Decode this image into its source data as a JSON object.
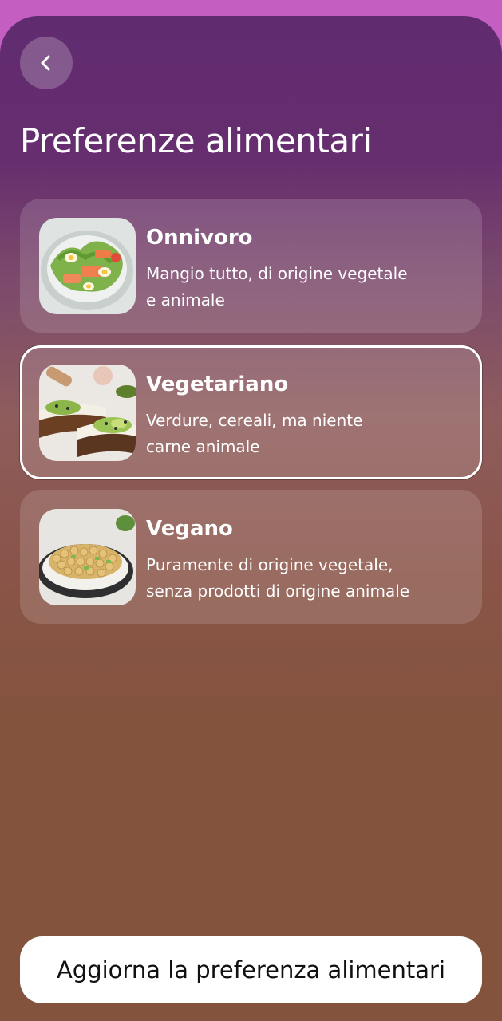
{
  "screen": {
    "title": "Preferenze alimentari",
    "back_icon": "chevron-left-icon"
  },
  "options": [
    {
      "label": "Onnivoro",
      "desc_line1": "Mangio tutto, di origine vegetale",
      "desc_line2": "e animale",
      "image": "salad-with-salmon-and-eggs-image",
      "selected": false
    },
    {
      "label": "Vegetariano",
      "desc_line1": "Verdure, cereali, ma niente",
      "desc_line2": "carne animale",
      "image": "avocado-toast-image",
      "selected": true
    },
    {
      "label": "Vegano",
      "desc_line1": "Puramente di origine vegetale,",
      "desc_line2": "senza prodotti di origine animale",
      "image": "chickpea-salad-image",
      "selected": false
    }
  ],
  "footer": {
    "cta_label": "Aggiorna la preferenza alimentari"
  },
  "colors": {
    "header_purple": "#612b70",
    "body_brown": "#83533d",
    "status_bar_magenta": "#c45ec0",
    "selected_border": "#ffffff"
  }
}
